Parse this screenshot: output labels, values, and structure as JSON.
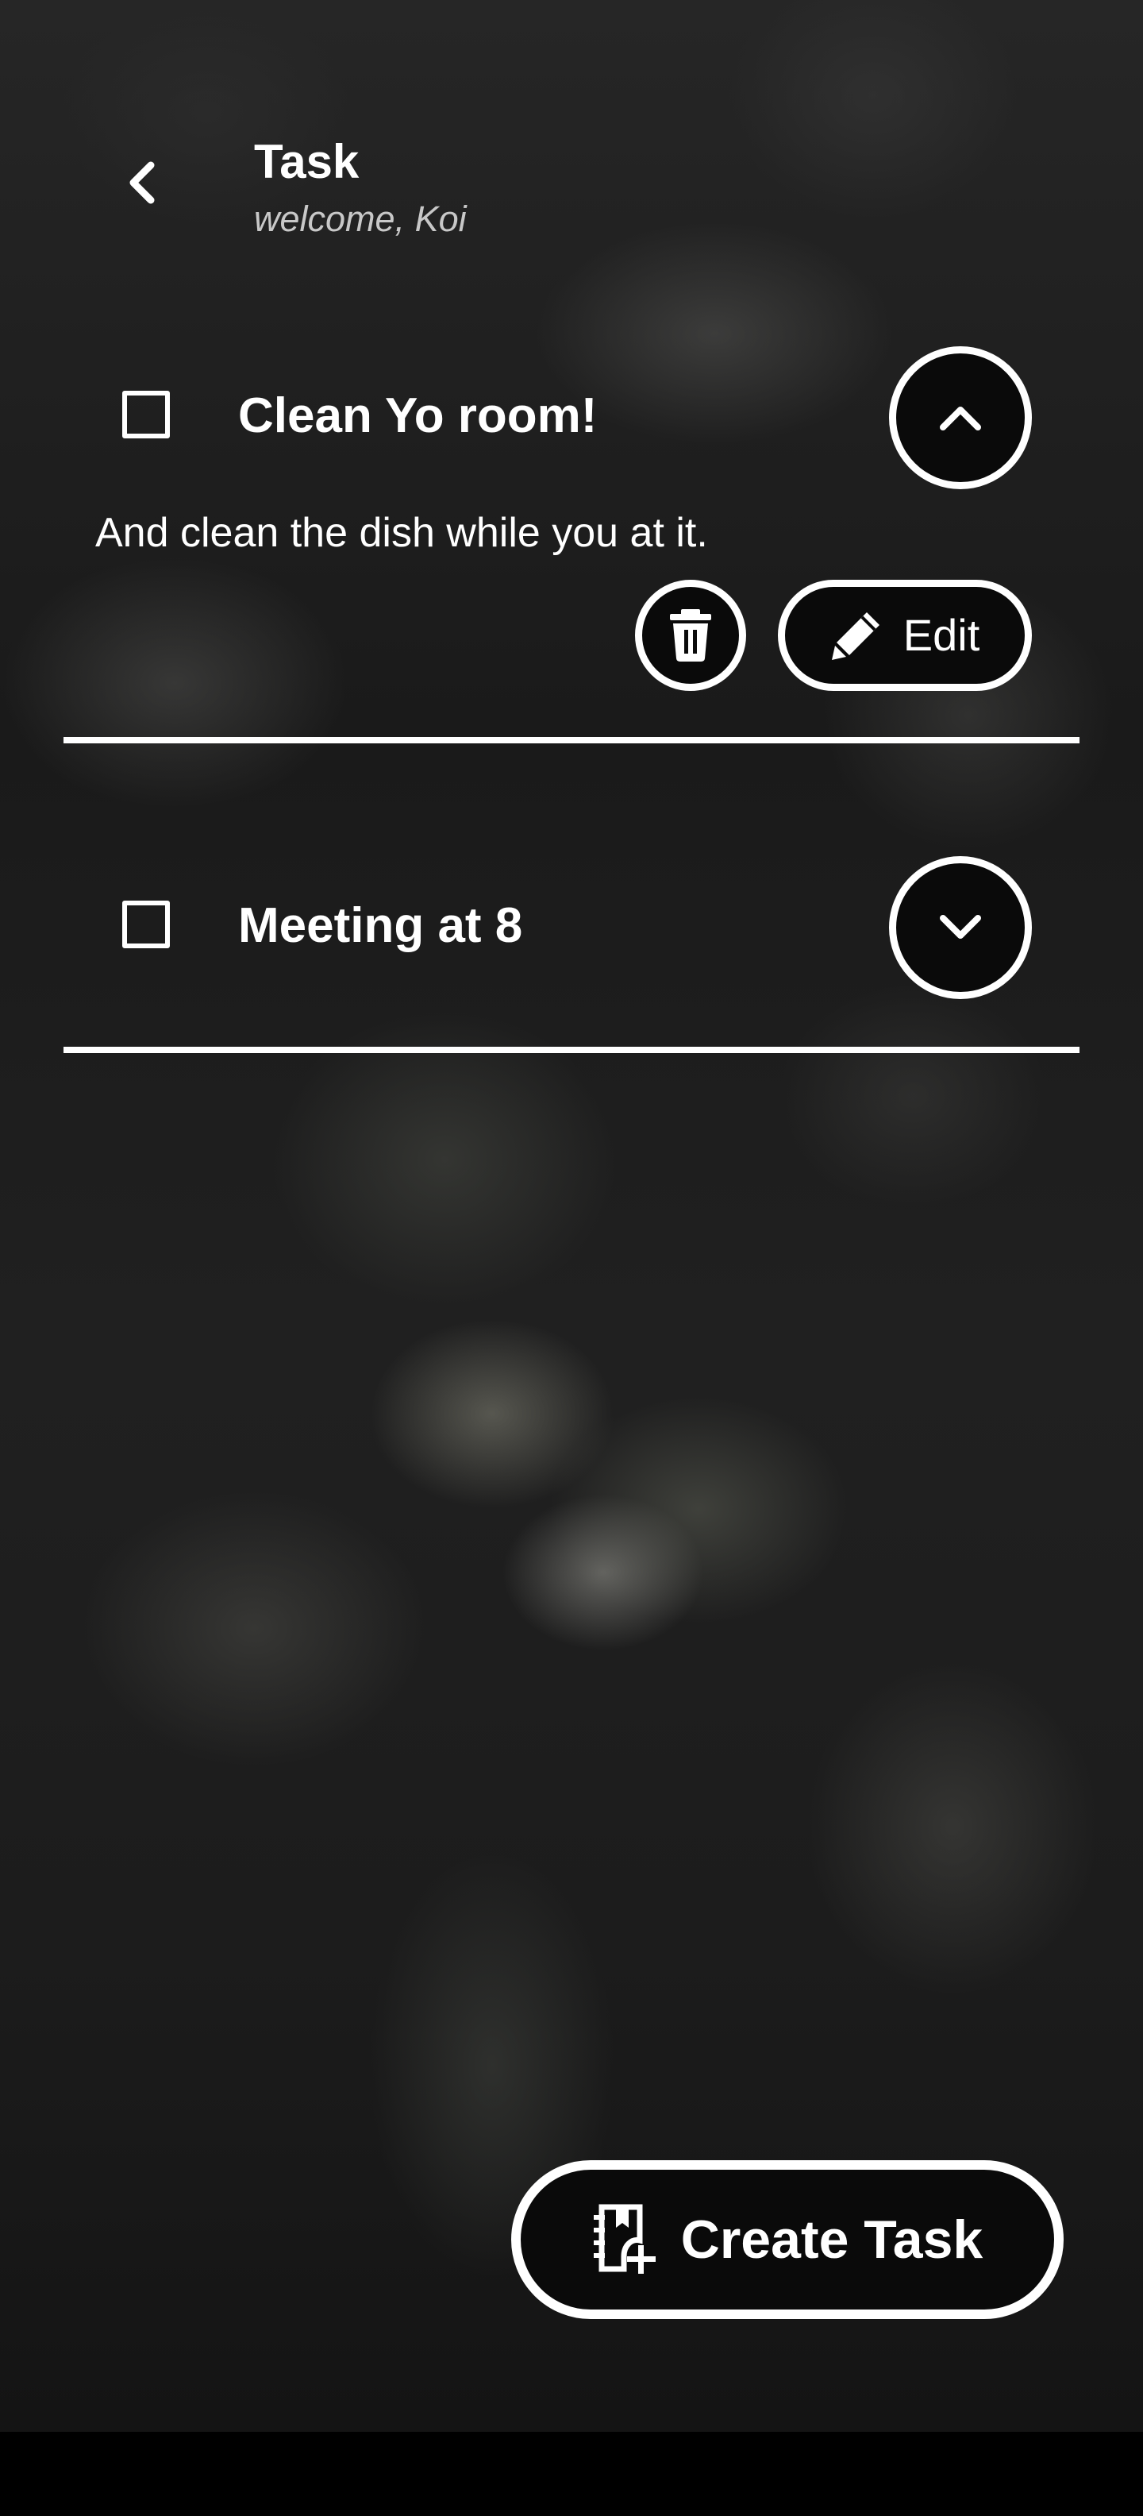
{
  "header": {
    "title": "Task",
    "subtitle": "welcome, Koi",
    "back_icon": "chevron-left-icon"
  },
  "tasks": [
    {
      "title": "Clean Yo room!",
      "description": "And clean the dish while you at it.",
      "checked": false,
      "expanded": true,
      "toggle_icon": "chevron-up-icon",
      "delete_icon": "trash-icon",
      "edit_icon": "pencil-icon",
      "edit_label": "Edit"
    },
    {
      "title": "Meeting at 8",
      "checked": false,
      "expanded": false,
      "toggle_icon": "chevron-down-icon"
    }
  ],
  "create_button": {
    "label": "Create Task",
    "icon": "notebook-plus-icon"
  },
  "colors": {
    "foreground": "#ffffff",
    "button_fill": "#0a0a0a",
    "subtitle": "#c8c8c8",
    "navbar": "#000000"
  }
}
